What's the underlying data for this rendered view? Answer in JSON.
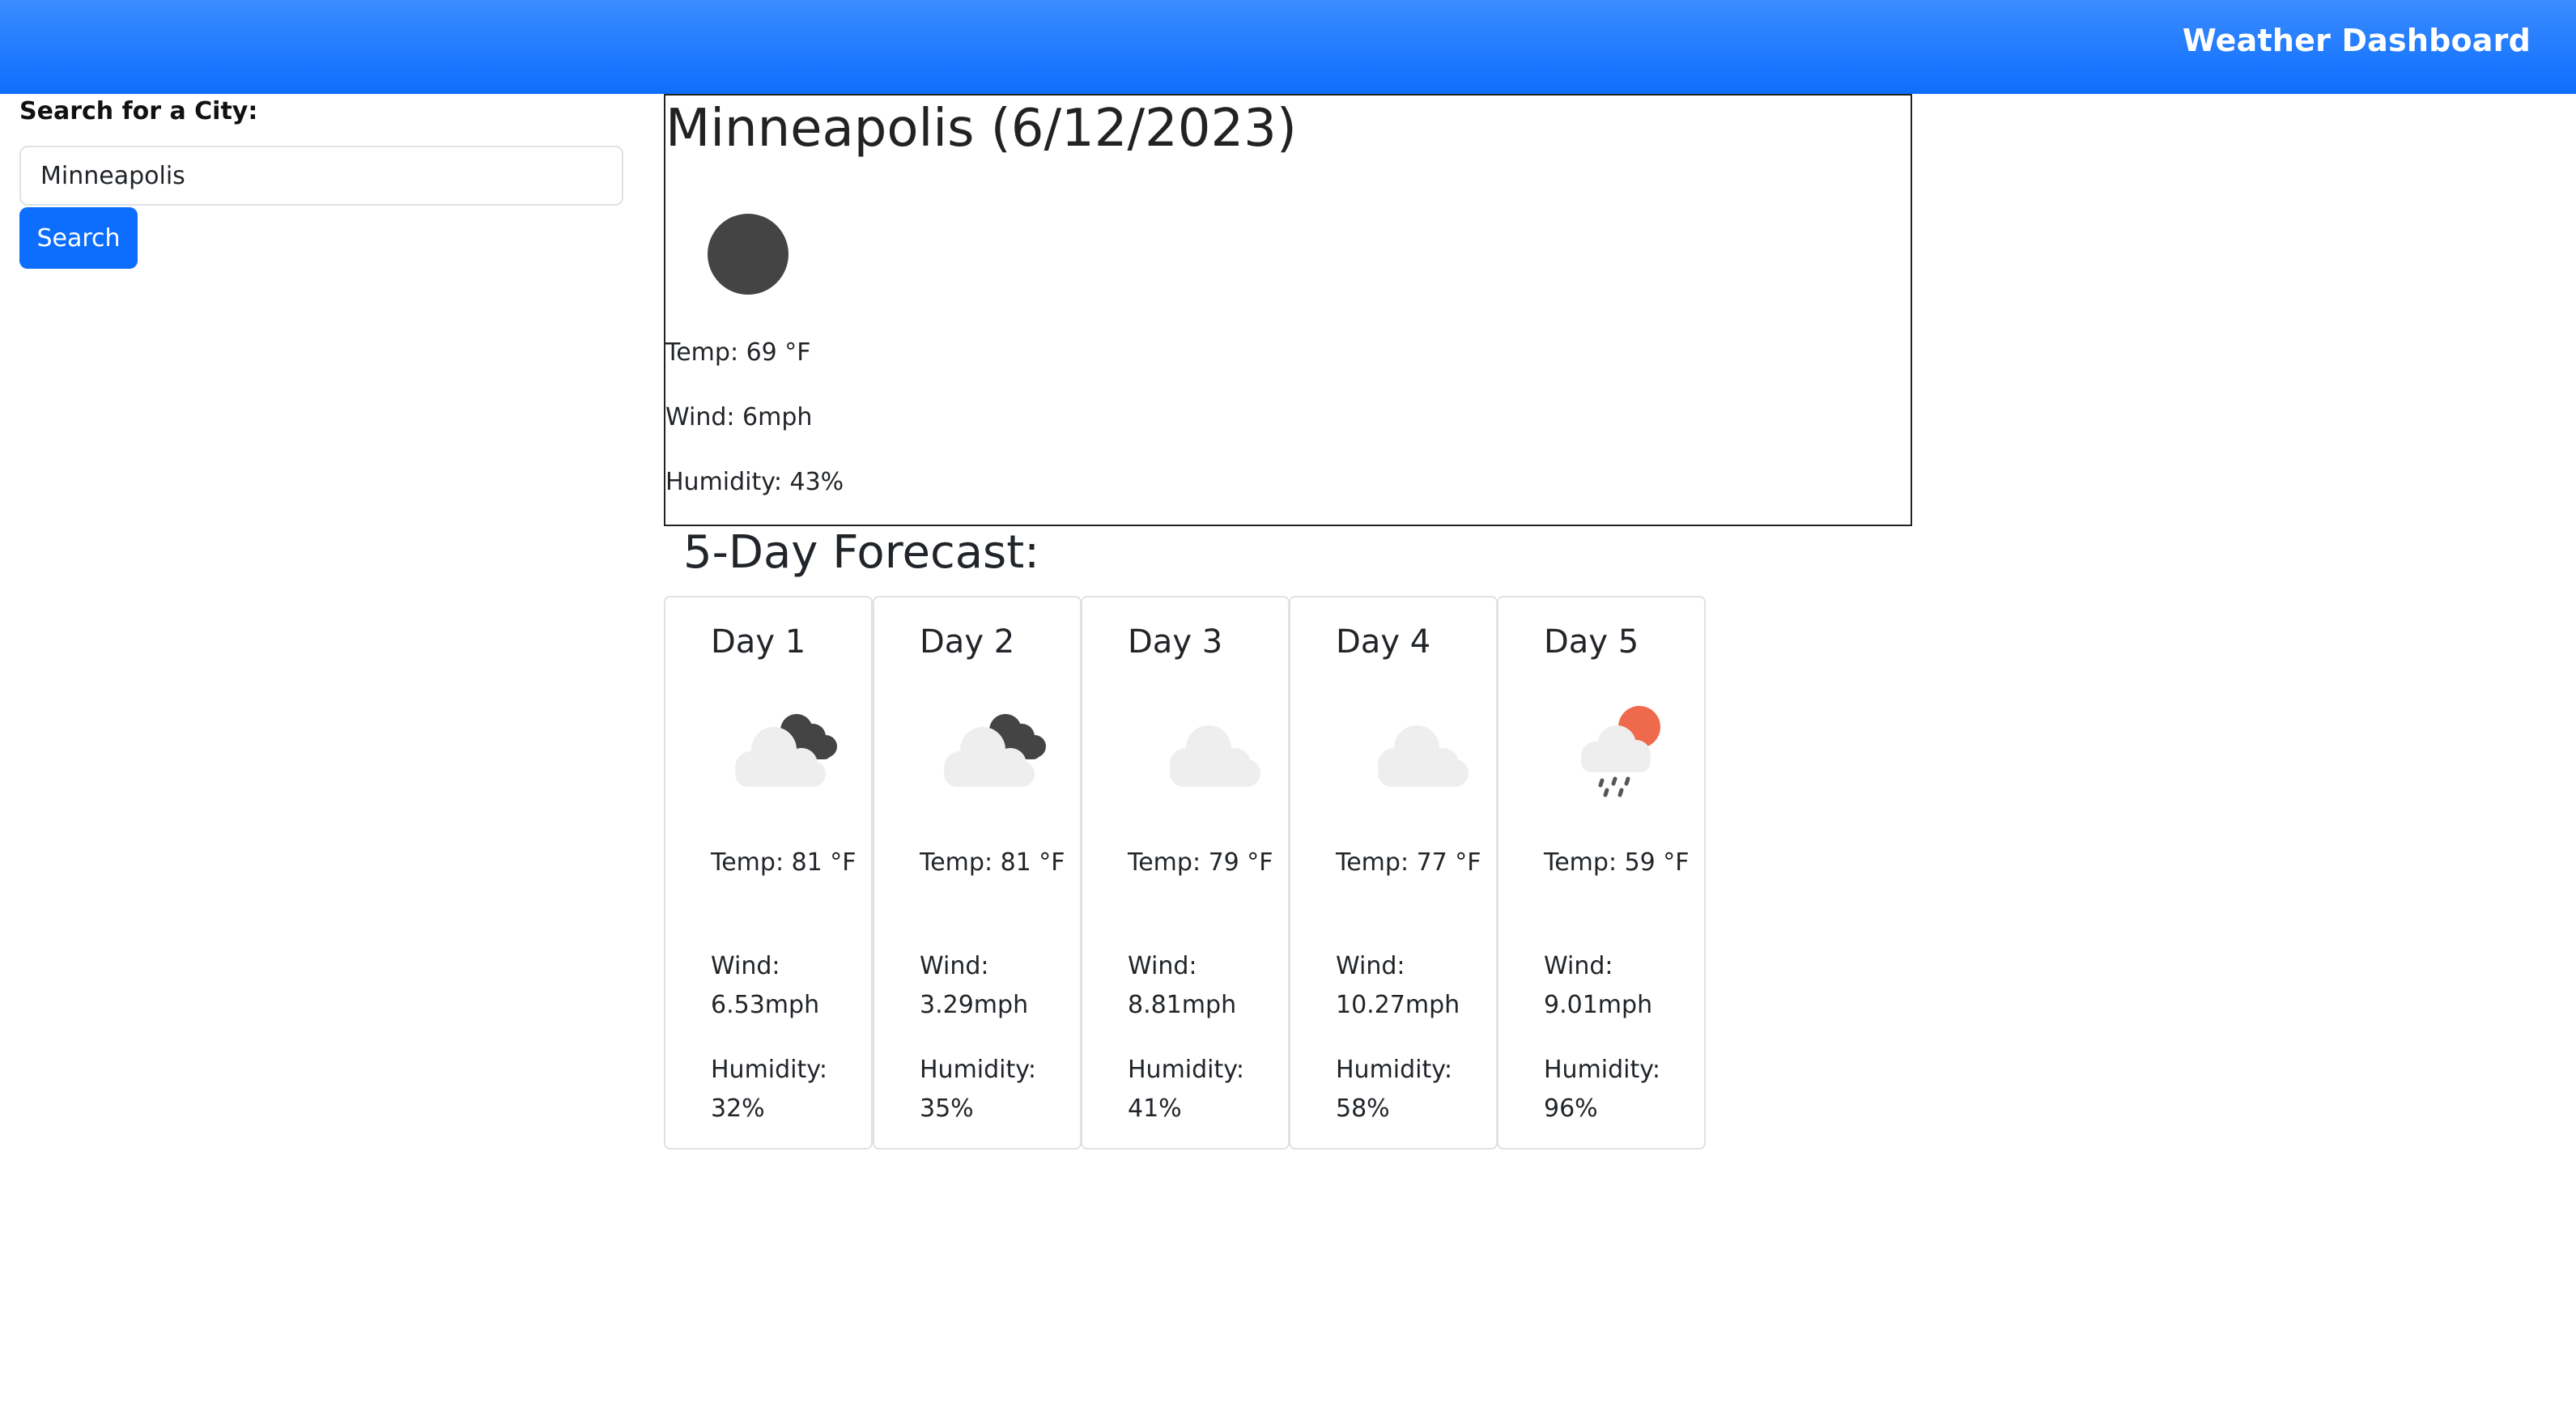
{
  "header": {
    "title": "Weather Dashboard"
  },
  "search": {
    "label": "Search for a City:",
    "value": "Minneapolis",
    "placeholder": "",
    "button_label": "Search"
  },
  "current": {
    "title": "Minneapolis (6/12/2023)",
    "icon": "dark-circle-icon",
    "temp": "Temp: 69 °F",
    "wind": "Wind: 6mph",
    "humidity": "Humidity: 43%"
  },
  "forecast": {
    "heading": "5-Day Forecast:",
    "days": [
      {
        "title": "Day 1",
        "icon": "broken-clouds-night-icon",
        "temp": "Temp: 81 °F",
        "wind": "Wind: 6.53mph",
        "humidity": "Humidity: 32%"
      },
      {
        "title": "Day 2",
        "icon": "broken-clouds-night-icon",
        "temp": "Temp: 81 °F",
        "wind": "Wind: 3.29mph",
        "humidity": "Humidity: 35%"
      },
      {
        "title": "Day 3",
        "icon": "cloud-icon",
        "temp": "Temp: 79 °F",
        "wind": "Wind: 8.81mph",
        "humidity": "Humidity: 41%"
      },
      {
        "title": "Day 4",
        "icon": "cloud-icon",
        "temp": "Temp: 77 °F",
        "wind": "Wind: 10.27mph",
        "humidity": "Humidity: 58%"
      },
      {
        "title": "Day 5",
        "icon": "rain-sun-icon",
        "temp": "Temp: 59 °F",
        "wind": "Wind: 9.01mph",
        "humidity": "Humidity: 96%"
      }
    ]
  },
  "colors": {
    "header": "#0d6efd",
    "button": "#0d6efd",
    "sun": "#ef6a4c",
    "dark_cloud": "#444444",
    "light_cloud": "#eeeeee"
  }
}
